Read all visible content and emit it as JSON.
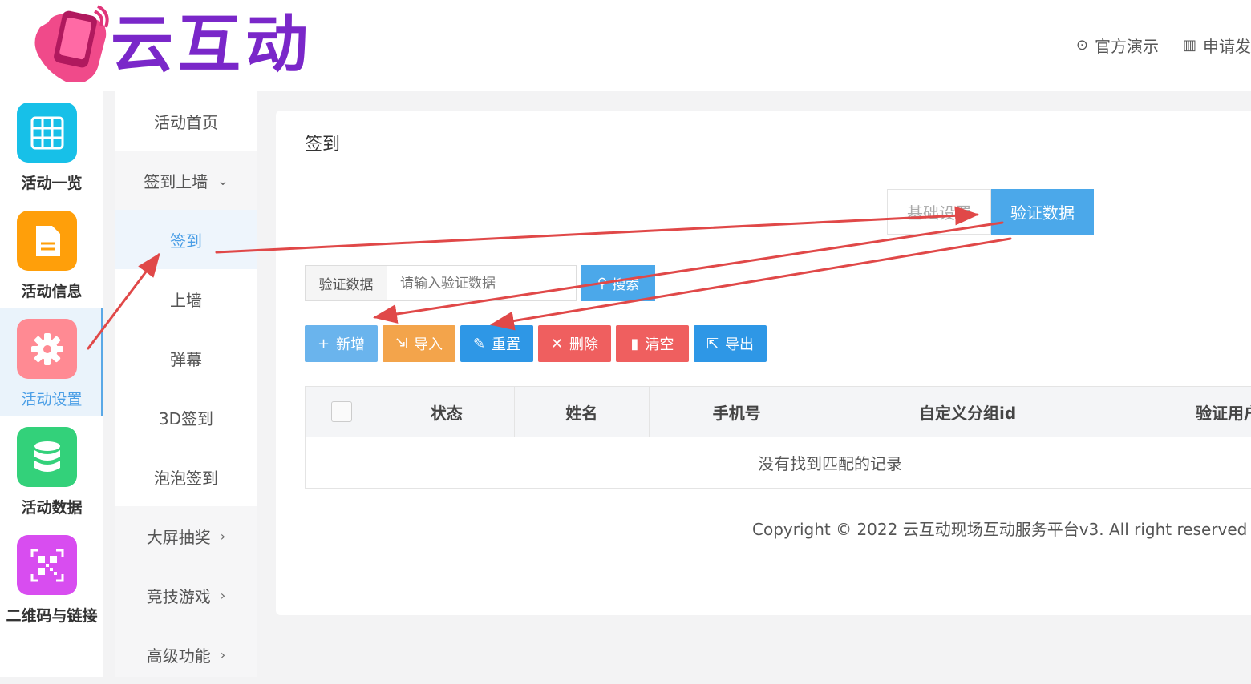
{
  "brand": {
    "name": "云互动"
  },
  "top_links": [
    {
      "label": "官方演示",
      "icon": "play-circle-icon"
    },
    {
      "label": "申请发",
      "icon": "barcode-icon"
    }
  ],
  "rail": [
    {
      "label": "活动一览",
      "icon": "grid-icon",
      "color": "#17c0e8"
    },
    {
      "label": "活动信息",
      "icon": "document-icon",
      "color": "#ff9f0a"
    },
    {
      "label": "活动设置",
      "icon": "gear-icon",
      "color": "#ff8a93",
      "active": true
    },
    {
      "label": "活动数据",
      "icon": "database-icon",
      "color": "#33d17a"
    },
    {
      "label": "二维码与链接",
      "icon": "qrcode-icon",
      "color": "#d84df0"
    }
  ],
  "submenu": {
    "home": "活动首页",
    "signin_wall": "签到上墙",
    "signin": "签到",
    "wall": "上墙",
    "danmu": "弹幕",
    "signin3d": "3D签到",
    "bubble": "泡泡签到",
    "lottery": "大屏抽奖",
    "games": "竞技游戏",
    "advanced": "高级功能"
  },
  "panel": {
    "title": "签到",
    "tabs": {
      "basic": "基础设置",
      "verify": "验证数据"
    },
    "search": {
      "label": "验证数据",
      "placeholder": "请输入验证数据",
      "button": "搜索"
    },
    "actions": {
      "add": "新增",
      "import": "导入",
      "reset": "重置",
      "delete": "删除",
      "clear": "清空",
      "export": "导出"
    },
    "table": {
      "headers": [
        "状态",
        "姓名",
        "手机号",
        "自定义分组id",
        "验证用户"
      ],
      "empty": "没有找到匹配的记录"
    },
    "copyright": "Copyright © 2022 云互动现场互动服务平台v3. All right reserved"
  },
  "colors": {
    "primary": "#4ba8ea",
    "danger": "#ef5f5f",
    "warning": "#f3a44b",
    "arrow": "#e04848"
  }
}
